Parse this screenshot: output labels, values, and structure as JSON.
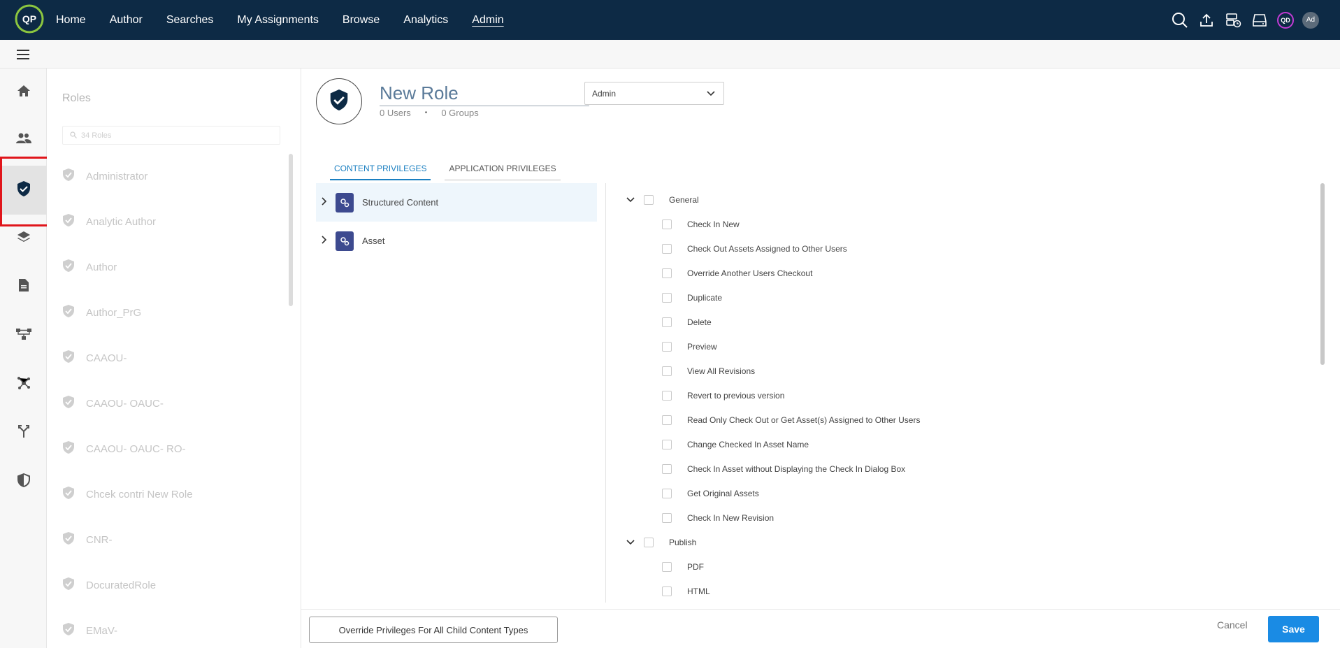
{
  "topnav": {
    "logo_text": "QP",
    "items": [
      {
        "label": "Home"
      },
      {
        "label": "Author"
      },
      {
        "label": "Searches"
      },
      {
        "label": "My Assignments"
      },
      {
        "label": "Browse"
      },
      {
        "label": "Analytics"
      },
      {
        "label": "Admin"
      }
    ],
    "active": "Admin",
    "icons": [
      "search-icon",
      "upload-icon",
      "server-clock-icon",
      "drive-icon"
    ],
    "avatar_qd": "QD",
    "avatar_ad": "Ad"
  },
  "rail": {
    "icons": [
      "home-icon",
      "users-icon",
      "shield-check-icon",
      "layers-icon",
      "document-icon",
      "workflow-icon",
      "network-icon",
      "branch-icon",
      "security-shield-icon"
    ],
    "selected": "shield-check-icon"
  },
  "roles": {
    "title": "Roles",
    "search_placeholder": "34 Roles",
    "items": [
      {
        "label": "Administrator"
      },
      {
        "label": "Analytic Author"
      },
      {
        "label": "Author"
      },
      {
        "label": "Author_PrG"
      },
      {
        "label": "CAAOU-"
      },
      {
        "label": "CAAOU- OAUC-"
      },
      {
        "label": "CAAOU- OAUC- RO-"
      },
      {
        "label": "Chcek contri New Role"
      },
      {
        "label": "CNR-"
      },
      {
        "label": "DocuratedRole"
      },
      {
        "label": "EMaV-"
      }
    ]
  },
  "role": {
    "name": "New Role",
    "users": "0 Users",
    "separator": "•",
    "groups": "0 Groups",
    "type_select": "Admin"
  },
  "tabs": [
    {
      "label": "CONTENT PRIVILEGES"
    },
    {
      "label": "APPLICATION PRIVILEGES"
    }
  ],
  "content_types": [
    {
      "label": "Structured Content"
    },
    {
      "label": "Asset"
    }
  ],
  "privileges": {
    "general": {
      "label": "General",
      "items": [
        {
          "label": "Check In New"
        },
        {
          "label": "Check Out Assets Assigned to Other Users"
        },
        {
          "label": "Override Another Users Checkout"
        },
        {
          "label": "Duplicate"
        },
        {
          "label": "Delete"
        },
        {
          "label": "Preview"
        },
        {
          "label": "View All Revisions"
        },
        {
          "label": "Revert to previous version"
        },
        {
          "label": "Read Only Check Out or Get Asset(s) Assigned to Other Users"
        },
        {
          "label": "Change Checked In Asset Name"
        },
        {
          "label": "Check In Asset without Displaying the Check In Dialog Box"
        },
        {
          "label": "Get Original Assets"
        },
        {
          "label": "Check In New Revision"
        }
      ]
    },
    "publish": {
      "label": "Publish",
      "items": [
        {
          "label": "PDF"
        },
        {
          "label": "HTML"
        }
      ]
    }
  },
  "footer": {
    "override_label": "Override Privileges For All Child Content Types",
    "cancel_label": "Cancel",
    "save_label": "Save"
  },
  "colors": {
    "topbar": "#0d2a45",
    "accent": "#1a8be4",
    "highlight_box": "#e0151b",
    "content_icon": "#3d4a8f"
  }
}
